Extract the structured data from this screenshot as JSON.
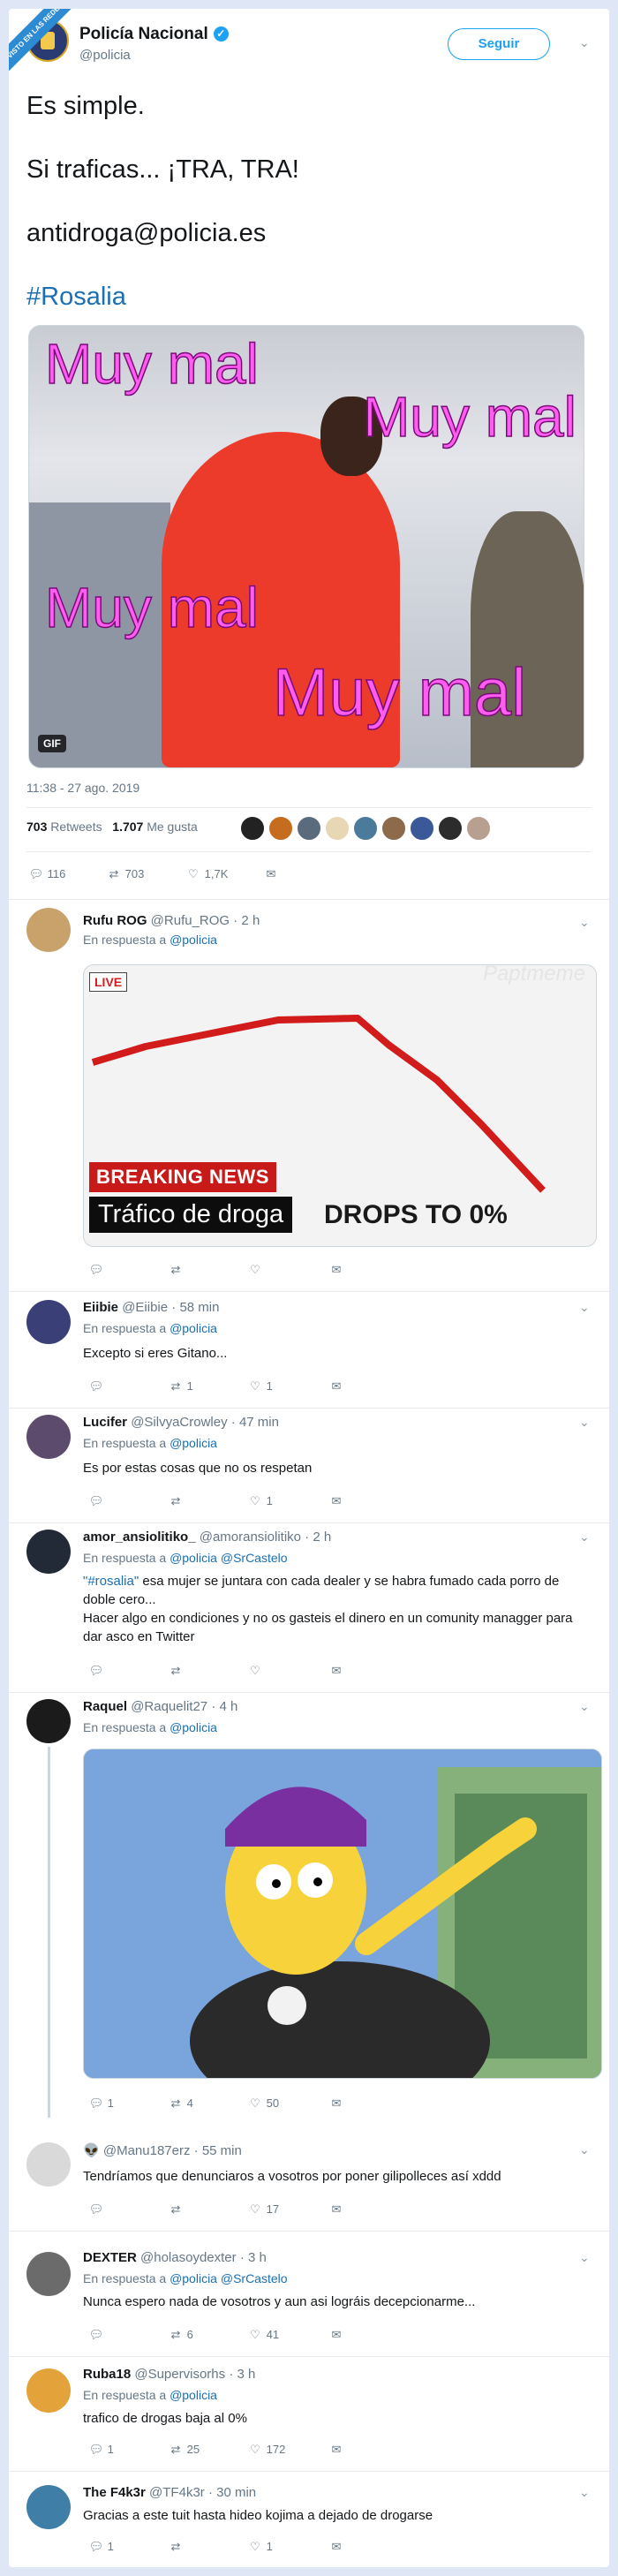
{
  "badge": "VISTO EN LAS REDES",
  "account": {
    "name": "Policía Nacional",
    "handle": "@policia",
    "follow_label": "Seguir"
  },
  "tweet": {
    "line1": "Es simple.",
    "line2": "Si traficas... ¡TRA, TRA!",
    "line3": "antidroga@policia.es",
    "hashtag": "#Rosalia",
    "gif_captions": [
      "Muy mal",
      "Muy mal",
      "Muy mal",
      "Muy mal"
    ],
    "gif_badge": "GIF",
    "timestamp": "11:38 - 27 ago. 2019",
    "retweets": "703",
    "retweets_label": "Retweets",
    "likes": "1.707",
    "likes_label": "Me gusta",
    "actions": {
      "replies": "116",
      "retweets": "703",
      "likes": "1,7K"
    }
  },
  "replies": [
    {
      "name": "Rufu ROG",
      "handle": "@Rufu_ROG",
      "time": "· 2 h",
      "in_reply": "En respuesta a",
      "mentions": "@policia",
      "media": {
        "live": "LIVE",
        "breaking": "BREAKING NEWS",
        "headline": "Tráfico de droga",
        "drops": "DROPS TO 0%",
        "watermark": "Paptmeme"
      },
      "actions": {
        "replies": "",
        "retweets": "",
        "likes": ""
      }
    },
    {
      "name": "Eiibie",
      "handle": "@Eiibie",
      "time": "· 58 min",
      "in_reply": "En respuesta a",
      "mentions": "@policia",
      "text": "Excepto si eres Gitano...",
      "actions": {
        "replies": "",
        "retweets": "1",
        "likes": "1"
      }
    },
    {
      "name": "Lucifer",
      "handle": "@SilvyaCrowley",
      "time": "· 47 min",
      "in_reply": "En respuesta a",
      "mentions": "@policia",
      "text": "Es por estas cosas que no os respetan",
      "actions": {
        "replies": "",
        "retweets": "",
        "likes": "1"
      }
    },
    {
      "name": "amor_ansiolitiko_",
      "handle": "@amoransiolitiko",
      "time": "· 2 h",
      "in_reply": "En respuesta a",
      "mentions": "@policia @SrCastelo",
      "text_mention": "\"#rosalia\"",
      "text": " esa mujer se juntara con cada dealer y se habra fumado cada porro de doble cero...",
      "text2": "Hacer algo en condiciones y no os gasteis el dinero en un comunity managger para dar asco en Twitter",
      "actions": {
        "replies": "",
        "retweets": "",
        "likes": ""
      }
    },
    {
      "name": "Raquel",
      "handle": "@Raquelit27",
      "time": "· 4 h",
      "in_reply": "En respuesta a",
      "mentions": "@policia",
      "actions": {
        "replies": "1",
        "retweets": "4",
        "likes": "50"
      }
    },
    {
      "name": "👽",
      "handle": "@Manu187erz",
      "time": "· 55 min",
      "text": "Tendríamos que denunciaros a vosotros por poner gilipolleces así xddd",
      "actions": {
        "replies": "",
        "retweets": "",
        "likes": "17"
      }
    },
    {
      "name": "DEXTER",
      "handle": "@holasoydexter",
      "time": "· 3 h",
      "in_reply": "En respuesta a",
      "mentions": "@policia @SrCastelo",
      "text": "Nunca espero nada de vosotros y aun asi lográis decepcionarme...",
      "actions": {
        "replies": "",
        "retweets": "6",
        "likes": "41"
      }
    },
    {
      "name": "Ruba18",
      "handle": "@Supervisorhs",
      "time": "· 3 h",
      "in_reply": "En respuesta a",
      "mentions": "@policia",
      "text": "trafico de drogas baja al 0%",
      "actions": {
        "replies": "1",
        "retweets": "25",
        "likes": "172"
      }
    },
    {
      "name": "The F4k3r",
      "handle": "@TF4k3r",
      "time": "· 30 min",
      "text": "Gracias a este tuit hasta hideo kojima a dejado de drogarse",
      "actions": {
        "replies": "1",
        "retweets": "",
        "likes": "1"
      }
    }
  ],
  "colors": {
    "accent": "#1da1f2",
    "mention": "#1b6fb3",
    "gif_text": "#ff5cf0",
    "breaking": "#c91a1a"
  },
  "icons": {
    "reply": "reply-icon",
    "retweet": "retweet-icon",
    "like": "heart-icon",
    "dm": "envelope-icon",
    "more": "chevron-down-icon"
  }
}
